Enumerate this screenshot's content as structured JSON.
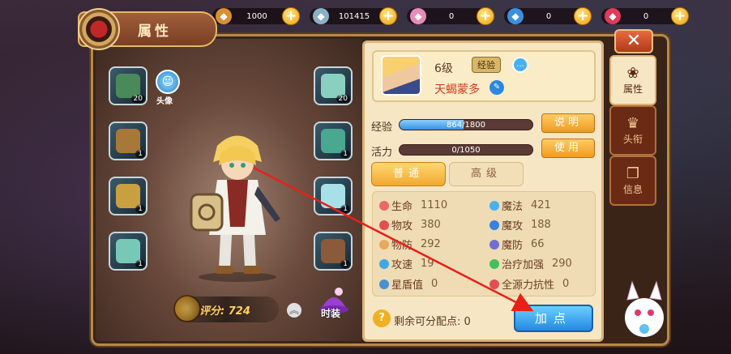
{
  "currency": [
    {
      "icon": "copper-coin-icon",
      "value": "1000",
      "color": "#d89030"
    },
    {
      "icon": "silver-coin-icon",
      "value": "101415",
      "color": "#8ab0c8"
    },
    {
      "icon": "pink-gem-icon",
      "value": "0",
      "color": "#e88ab8"
    },
    {
      "icon": "blue-gem-icon",
      "value": "0",
      "color": "#3a90e0"
    },
    {
      "icon": "red-gem-icon",
      "value": "0",
      "color": "#e03a5a"
    }
  ],
  "title": "属性",
  "avatar_label": "头像",
  "left_slots": [
    {
      "icon": "spellbook-icon",
      "count": "20",
      "color": "#4a8a5a"
    },
    {
      "icon": "emerald-ring-icon",
      "count": "1",
      "color": "#a87838"
    },
    {
      "icon": "moon-amulet-icon",
      "count": "1",
      "color": "#c8a040"
    },
    {
      "icon": "gauntlet-icon",
      "count": "1",
      "color": "#78c8b8"
    }
  ],
  "right_slots": [
    {
      "icon": "robe-icon",
      "count": "20",
      "color": "#8ad0c0"
    },
    {
      "icon": "bracelet-icon",
      "count": "1",
      "color": "#48a890"
    },
    {
      "icon": "pants-icon",
      "count": "1",
      "color": "#a8e0e8"
    },
    {
      "icon": "boots-icon",
      "count": "1",
      "color": "#8a5a3a"
    }
  ],
  "score": {
    "label": "评分: 724"
  },
  "fashion_label": "时装",
  "profile": {
    "level": "6级",
    "exp_badge": "经验",
    "name": "天蝎蒙多"
  },
  "exp": {
    "label": "经验",
    "text": "864/1800",
    "ratio": 0.48,
    "button": "说明"
  },
  "vitality": {
    "label": "活力",
    "text": "0/1050",
    "ratio": 0.0,
    "button": "使用"
  },
  "tabs": [
    {
      "label": "普通",
      "active": true
    },
    {
      "label": "高级",
      "active": false
    }
  ],
  "stats_left": [
    {
      "name": "生命",
      "value": "1110",
      "color": "#e86a6a"
    },
    {
      "name": "物攻",
      "value": "380",
      "color": "#e05050"
    },
    {
      "name": "物防",
      "value": "292",
      "color": "#e8a860"
    },
    {
      "name": "攻速",
      "value": "19",
      "color": "#40a8e0"
    },
    {
      "name": "星盾值",
      "value": "0",
      "color": "#4a90d0"
    }
  ],
  "stats_right": [
    {
      "name": "魔法",
      "value": "421",
      "color": "#4ab0f0"
    },
    {
      "name": "魔攻",
      "value": "188",
      "color": "#3a80e0"
    },
    {
      "name": "魔防",
      "value": "66",
      "color": "#7070d0"
    },
    {
      "name": "治疗加强",
      "value": "290",
      "color": "#40c060"
    },
    {
      "name": "全源力抗性",
      "value": "0",
      "color": "#e05050"
    }
  ],
  "remaining_label": "剩余可分配点: 0",
  "add_point_button": "加点",
  "side_tabs": [
    {
      "label": "属性",
      "icon": "attribute-icon",
      "glyph": "❀",
      "active": true
    },
    {
      "label": "头衔",
      "icon": "title-icon",
      "glyph": "♛",
      "active": false
    },
    {
      "label": "信息",
      "icon": "info-book-icon",
      "glyph": "❐",
      "active": false
    }
  ],
  "close_label": "✕"
}
